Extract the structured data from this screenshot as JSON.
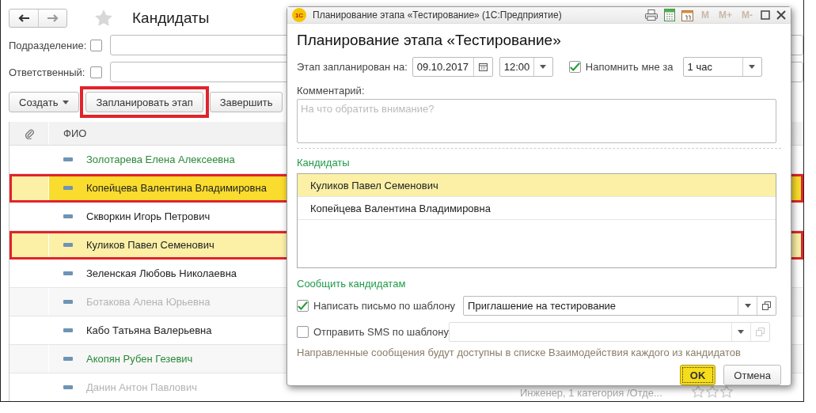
{
  "window": {
    "title": "Кандидаты"
  },
  "filters": [
    {
      "label": "Подразделение:",
      "checked": false
    },
    {
      "label": "Ответственный:",
      "checked": false
    }
  ],
  "toolbar": [
    {
      "label": "Создать",
      "kind": "menu",
      "highlighted": false
    },
    {
      "label": "Запланировать этап",
      "kind": "plain",
      "highlighted": true
    },
    {
      "label": "Завершить",
      "kind": "plain",
      "highlighted": false
    }
  ],
  "table": {
    "columns": [
      "ФИО"
    ],
    "rows": [
      {
        "name": "Золотарева Елена Алексеевна",
        "color": "#2a8a3a",
        "selected": false,
        "focused": false,
        "highlighted": false
      },
      {
        "name": "Копейцева Валентина Владимировна",
        "color": "#222222",
        "selected": true,
        "focused": true,
        "highlighted": true
      },
      {
        "name": "Скворкин Игорь Петрович",
        "color": "#222222",
        "selected": false,
        "focused": false,
        "highlighted": false
      },
      {
        "name": "Куликов Павел Семенович",
        "color": "#222222",
        "selected": true,
        "focused": false,
        "highlighted": true
      },
      {
        "name": "Зеленская Любовь Николаевна",
        "color": "#222222",
        "selected": false,
        "focused": false,
        "highlighted": false
      },
      {
        "name": "Ботакова Алена Юрьевна",
        "color": "#b4b4b4",
        "selected": false,
        "focused": false,
        "highlighted": false
      },
      {
        "name": "Кабо Татьяна Валерьевна",
        "color": "#222222",
        "selected": false,
        "focused": false,
        "highlighted": false
      },
      {
        "name": "Акопян Рубен Гезевич",
        "color": "#2a8a3a",
        "selected": false,
        "focused": false,
        "highlighted": false
      },
      {
        "name": "Данин Антон Павлович",
        "color": "#b4b4b4",
        "selected": false,
        "focused": false,
        "highlighted": false,
        "details": "Инженер, 1 категория /Отде...",
        "stars": 0
      }
    ]
  },
  "dialog": {
    "logo": "1С",
    "title": "Планирование этапа «Тестирование»  (1С:Предприятие)",
    "memory_keys": [
      "M",
      "M+",
      "M-"
    ],
    "heading": "Планирование этапа «Тестирование»",
    "schedule": {
      "label": "Этап запланирован на:",
      "date": "09.10.2017",
      "time": "12:00",
      "remind": {
        "label": "Напомнить мне за",
        "checked": true,
        "value": "1 час"
      }
    },
    "comment": {
      "label": "Комментарий:",
      "placeholder": "На что обратить внимание?"
    },
    "candidates": {
      "label": "Кандидаты",
      "items": [
        {
          "name": "Куликов Павел Семенович",
          "selected": true
        },
        {
          "name": "Копейцева Валентина Владимировна",
          "selected": false
        }
      ]
    },
    "notify": {
      "label": "Сообщить кандидатам",
      "options": [
        {
          "label": "Написать письмо по шаблону",
          "checked": true,
          "value": "Приглашение на тестирование"
        },
        {
          "label": "Отправить SMS по шаблону",
          "checked": false
        }
      ],
      "note": "Направленные сообщения будут доступны в списке Взаимодействия каждого из кандидатов"
    },
    "buttons": [
      {
        "label": "OK",
        "default": true
      },
      {
        "label": "Отмена",
        "default": false
      }
    ]
  }
}
